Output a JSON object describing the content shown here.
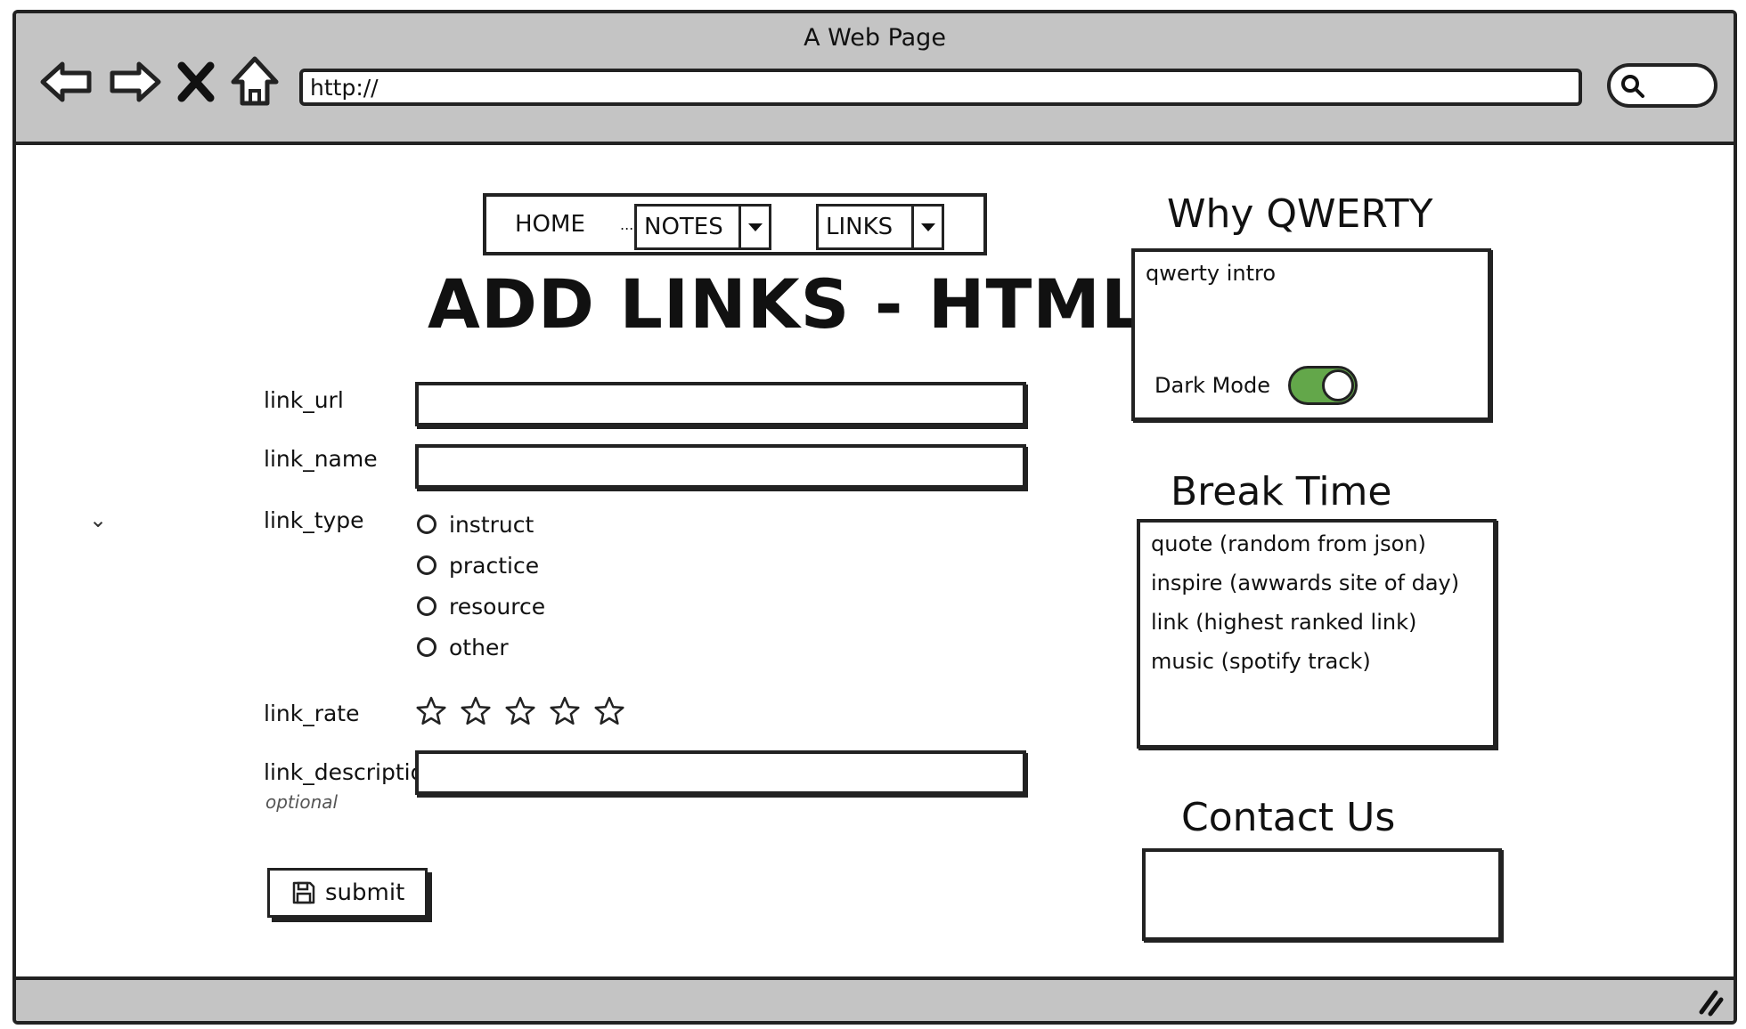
{
  "window": {
    "title": "A Web Page",
    "address": "http://"
  },
  "nav": {
    "home": "HOME",
    "dots": "...",
    "notes": "NOTES",
    "links": "LINKS"
  },
  "page_title": "ADD LINKS - HTML",
  "form": {
    "url_label": "link_url",
    "name_label": "link_name",
    "type_label": "link_type",
    "type_options": [
      "instruct",
      "practice",
      "resource",
      "other"
    ],
    "rate_label": "link_rate",
    "rating": 0,
    "rating_max": 5,
    "description_label": "link_description",
    "description_note": "optional",
    "submit_label": "submit"
  },
  "sidebar": {
    "why_title": "Why QWERTY",
    "why_intro": "qwerty intro",
    "dark_mode_label": "Dark Mode",
    "dark_mode_on": true,
    "break_title": "Break Time",
    "break_items": [
      "quote (random from json)",
      "inspire (awwards site of day)",
      "link (highest ranked link)",
      "music (spotify track)"
    ],
    "contact_title": "Contact Us"
  },
  "colors": {
    "chrome": "#c4c4c4",
    "toggle_on": "#63a74a",
    "border": "#222222"
  }
}
